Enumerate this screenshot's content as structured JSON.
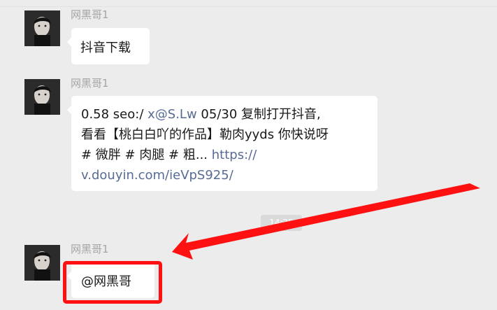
{
  "chat": {
    "messages": [
      {
        "sender": "网黑哥1",
        "text": "抖音下载"
      },
      {
        "sender": "网黑哥1",
        "line1_prefix": "0.58 seo:/ ",
        "line1_link": "x@S.Lw",
        "line1_suffix": " 05/30 复制打开抖音,",
        "line2": "看看【桃白白吖的作品】勒肉yyds 你快说呀",
        "line3_prefix": "# 微胖 # 肉腿 # 粗... ",
        "line3_link": "https://",
        "line4_link": "v.douyin.com/ieVpS925/"
      },
      {
        "sender": "网黑哥1",
        "text": "@网黑哥"
      }
    ],
    "timestamp": "14:25"
  },
  "colors": {
    "background": "#ececec",
    "bubble": "#ffffff",
    "link": "#576b95",
    "annotation": "#ff1111"
  }
}
